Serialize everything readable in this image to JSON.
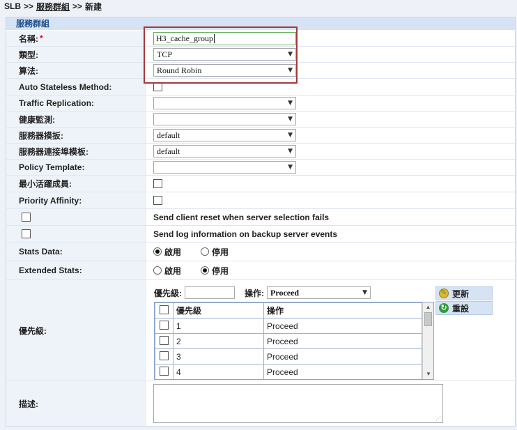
{
  "breadcrumb": {
    "root": "SLB",
    "sep": ">>",
    "level2": "服務群組",
    "current": "新建"
  },
  "panel_title": "服務群組",
  "fields": {
    "name": {
      "label": "名稱:",
      "required": "*",
      "value": "H3_cache_group"
    },
    "type": {
      "label": "類型:",
      "value": "TCP"
    },
    "algorithm": {
      "label": "算法:",
      "value": "Round Robin"
    },
    "auto_stateless": {
      "label": "Auto Stateless Method:"
    },
    "traffic_replication": {
      "label": "Traffic Replication:",
      "value": ""
    },
    "health_monitor": {
      "label": "健康監測:",
      "value": ""
    },
    "server_template": {
      "label": "服務器摸扳:",
      "value": "default"
    },
    "server_port_template": {
      "label": "服務器連接埠模板:",
      "value": "default"
    },
    "policy_template": {
      "label": "Policy Template:",
      "value": ""
    },
    "min_active": {
      "label": "最小活躍成員:"
    },
    "priority_affinity": {
      "label": "Priority Affinity:"
    },
    "client_reset": {
      "label": "Send client reset when server selection fails"
    },
    "send_log": {
      "label": "Send log information on backup server events"
    },
    "stats_data": {
      "label": "Stats Data:",
      "opt_on": "啟用",
      "opt_off": "停用",
      "selected": "啟用"
    },
    "extended_stats": {
      "label": "Extended Stats:",
      "opt_on": "啟用",
      "opt_off": "停用",
      "selected": "停用"
    },
    "priority": {
      "label": "優先級:",
      "input_label": "優先級:",
      "action_label": "操作:",
      "action_value": "Proceed",
      "columns": [
        "優先級",
        "操作"
      ],
      "rows": [
        {
          "priority": "1",
          "action": "Proceed"
        },
        {
          "priority": "2",
          "action": "Proceed"
        },
        {
          "priority": "3",
          "action": "Proceed"
        },
        {
          "priority": "4",
          "action": "Proceed"
        }
      ],
      "update_label": "更新",
      "reset_label": "重設"
    },
    "description": {
      "label": "描述:",
      "value": ""
    }
  },
  "colors": {
    "highlight_border": "#a33a3a",
    "label_bg": "#eef3fa",
    "title_text": "#1c4f8b"
  }
}
